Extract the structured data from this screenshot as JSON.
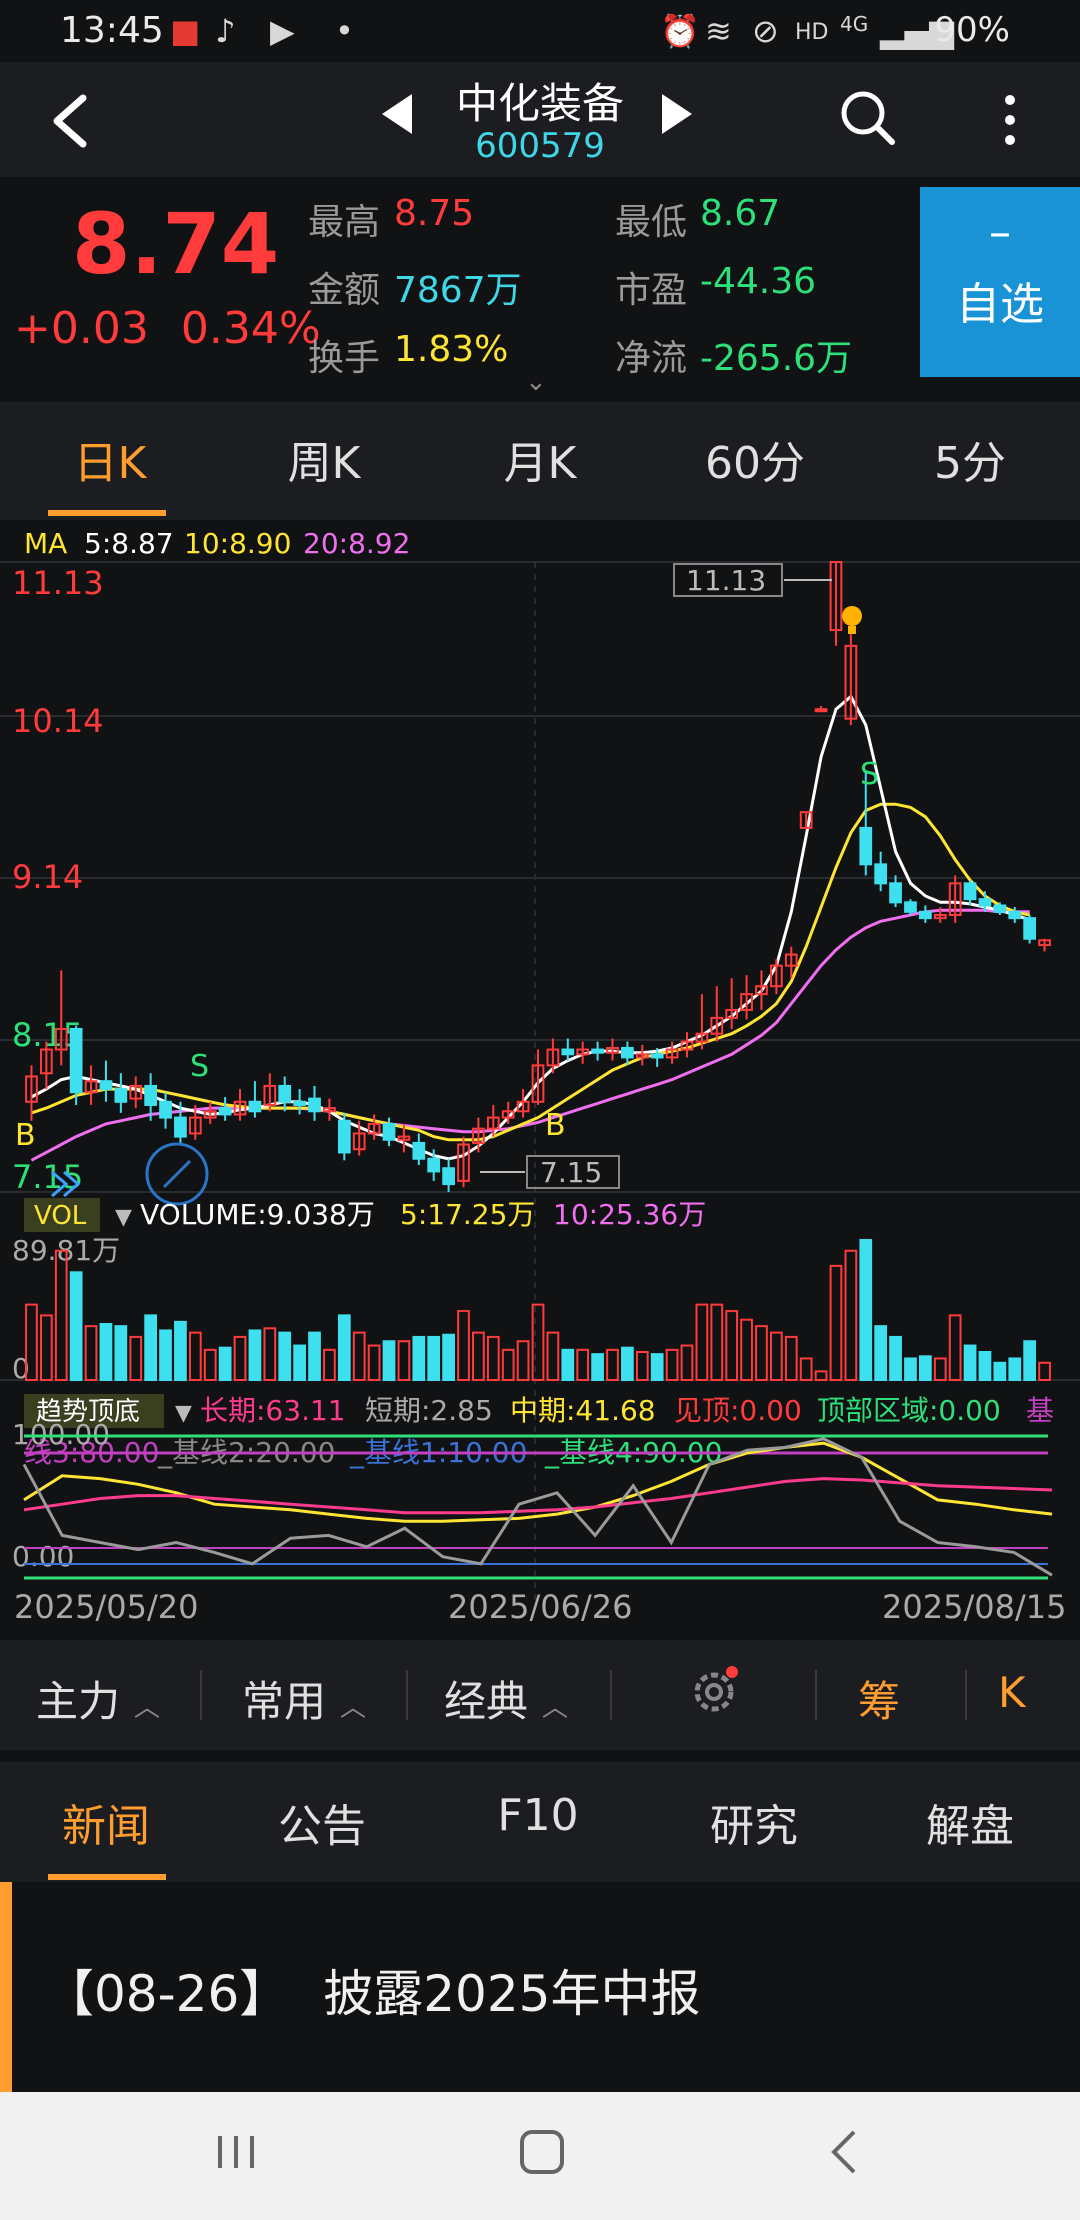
{
  "status_bar": {
    "time": "13:45",
    "network": "4G",
    "hd": "HD",
    "battery": "90%"
  },
  "header": {
    "stock_name": "中化装备",
    "stock_code": "600579"
  },
  "quote": {
    "last_price": "8.74",
    "change": "+0.03",
    "change_pct": "0.34%",
    "fields": [
      {
        "label": "最高",
        "value": "8.75",
        "color": "#ff3b3b"
      },
      {
        "label": "最低",
        "value": "8.67",
        "color": "#2ee07a"
      },
      {
        "label": "金额",
        "value": "7867万",
        "color": "#3ed7e8"
      },
      {
        "label": "市盈",
        "value": "-44.36",
        "color": "#2ee07a"
      },
      {
        "label": "换手",
        "value": "1.83%",
        "color": "#ffe533"
      },
      {
        "label": "净流",
        "value": "-265.6万",
        "color": "#2ee07a"
      }
    ],
    "watch_button": {
      "minus": "–",
      "label": "自选"
    }
  },
  "period_tabs": [
    "日K",
    "周K",
    "月K",
    "60分",
    "5分"
  ],
  "chart": {
    "ma_legend": {
      "label": "MA",
      "ma5": "5:8.87",
      "ma10": "10:8.90",
      "ma20": "20:8.92"
    },
    "price_ticks": [
      "11.13",
      "10.14",
      "9.14",
      "8.15",
      "7.15"
    ],
    "high_marker": "11.13",
    "low_marker": "7.15",
    "buy_label": "B",
    "sell_label": "S",
    "vol_legend": {
      "tag": "VOL",
      "volume": "VOLUME:9.038万",
      "v5": "5:17.25万",
      "v10": "10:25.36万"
    },
    "vol_top": "89.81万",
    "vol_zero": "0",
    "ind_legend": {
      "tag": "趋势顶底",
      "long": "长期:63.11",
      "short": "短期:2.85",
      "mid": "中期:41.68",
      "top_seen": "见顶:0.00",
      "top_zone": "顶部区域:0.00",
      "tail": "基",
      "base_line3": "线3:80.00",
      "base_line2": "_基线2:20.00",
      "base_line1": "_基线1:10.00",
      "base_line4": "_基线4:90.00"
    },
    "ind_top": "100.00",
    "ind_zero": "0.00",
    "dates": [
      "2025/05/20",
      "2025/06/26",
      "2025/08/15"
    ]
  },
  "chart_data": {
    "type": "candlestick",
    "ylim": [
      7.15,
      11.13
    ],
    "candles": [
      {
        "o": 7.72,
        "c": 7.88,
        "h": 7.95,
        "l": 7.6
      },
      {
        "o": 7.9,
        "c": 8.05,
        "h": 8.1,
        "l": 7.8
      },
      {
        "o": 8.05,
        "c": 8.18,
        "h": 8.55,
        "l": 7.95
      },
      {
        "o": 8.18,
        "c": 7.78,
        "h": 8.2,
        "l": 7.7
      },
      {
        "o": 7.78,
        "c": 7.85,
        "h": 7.95,
        "l": 7.7
      },
      {
        "o": 7.85,
        "c": 7.8,
        "h": 7.98,
        "l": 7.72
      },
      {
        "o": 7.8,
        "c": 7.72,
        "h": 7.9,
        "l": 7.65
      },
      {
        "o": 7.74,
        "c": 7.82,
        "h": 7.88,
        "l": 7.68
      },
      {
        "o": 7.82,
        "c": 7.7,
        "h": 7.9,
        "l": 7.6
      },
      {
        "o": 7.72,
        "c": 7.62,
        "h": 7.78,
        "l": 7.55
      },
      {
        "o": 7.62,
        "c": 7.5,
        "h": 7.72,
        "l": 7.45
      },
      {
        "o": 7.52,
        "c": 7.62,
        "h": 7.7,
        "l": 7.48
      },
      {
        "o": 7.62,
        "c": 7.66,
        "h": 7.72,
        "l": 7.58
      },
      {
        "o": 7.68,
        "c": 7.64,
        "h": 7.75,
        "l": 7.6
      },
      {
        "o": 7.64,
        "c": 7.72,
        "h": 7.8,
        "l": 7.6
      },
      {
        "o": 7.72,
        "c": 7.66,
        "h": 7.85,
        "l": 7.62
      },
      {
        "o": 7.7,
        "c": 7.82,
        "h": 7.9,
        "l": 7.66
      },
      {
        "o": 7.82,
        "c": 7.72,
        "h": 7.88,
        "l": 7.66
      },
      {
        "o": 7.72,
        "c": 7.7,
        "h": 7.8,
        "l": 7.64
      },
      {
        "o": 7.74,
        "c": 7.66,
        "h": 7.82,
        "l": 7.6
      },
      {
        "o": 7.66,
        "c": 7.68,
        "h": 7.74,
        "l": 7.6
      },
      {
        "o": 7.6,
        "c": 7.4,
        "h": 7.65,
        "l": 7.35
      },
      {
        "o": 7.42,
        "c": 7.52,
        "h": 7.6,
        "l": 7.38
      },
      {
        "o": 7.52,
        "c": 7.58,
        "h": 7.64,
        "l": 7.48
      },
      {
        "o": 7.58,
        "c": 7.48,
        "h": 7.62,
        "l": 7.44
      },
      {
        "o": 7.48,
        "c": 7.5,
        "h": 7.58,
        "l": 7.4
      },
      {
        "o": 7.46,
        "c": 7.36,
        "h": 7.52,
        "l": 7.32
      },
      {
        "o": 7.36,
        "c": 7.28,
        "h": 7.42,
        "l": 7.22
      },
      {
        "o": 7.3,
        "c": 7.2,
        "h": 7.36,
        "l": 7.15
      },
      {
        "o": 7.22,
        "c": 7.45,
        "h": 7.5,
        "l": 7.18
      },
      {
        "o": 7.46,
        "c": 7.55,
        "h": 7.62,
        "l": 7.4
      },
      {
        "o": 7.55,
        "c": 7.62,
        "h": 7.7,
        "l": 7.5
      },
      {
        "o": 7.62,
        "c": 7.66,
        "h": 7.72,
        "l": 7.58
      },
      {
        "o": 7.66,
        "c": 7.72,
        "h": 7.8,
        "l": 7.62
      },
      {
        "o": 7.72,
        "c": 7.95,
        "h": 8.05,
        "l": 7.7
      },
      {
        "o": 7.95,
        "c": 8.05,
        "h": 8.12,
        "l": 7.9
      },
      {
        "o": 8.05,
        "c": 8.02,
        "h": 8.12,
        "l": 7.98
      },
      {
        "o": 8.02,
        "c": 8.05,
        "h": 8.1,
        "l": 7.96
      },
      {
        "o": 8.05,
        "c": 8.03,
        "h": 8.1,
        "l": 7.98
      },
      {
        "o": 8.03,
        "c": 8.06,
        "h": 8.12,
        "l": 7.98
      },
      {
        "o": 8.06,
        "c": 8.0,
        "h": 8.1,
        "l": 7.95
      },
      {
        "o": 8.0,
        "c": 8.02,
        "h": 8.08,
        "l": 7.95
      },
      {
        "o": 8.02,
        "c": 8.0,
        "h": 8.06,
        "l": 7.94
      },
      {
        "o": 8.0,
        "c": 8.05,
        "h": 8.1,
        "l": 7.96
      },
      {
        "o": 8.05,
        "c": 8.1,
        "h": 8.16,
        "l": 8.0
      },
      {
        "o": 8.1,
        "c": 8.15,
        "h": 8.4,
        "l": 8.05
      },
      {
        "o": 8.15,
        "c": 8.25,
        "h": 8.45,
        "l": 8.1
      },
      {
        "o": 8.25,
        "c": 8.3,
        "h": 8.5,
        "l": 8.18
      },
      {
        "o": 8.3,
        "c": 8.4,
        "h": 8.52,
        "l": 8.24
      },
      {
        "o": 8.4,
        "c": 8.45,
        "h": 8.55,
        "l": 8.3
      },
      {
        "o": 8.45,
        "c": 8.58,
        "h": 8.62,
        "l": 8.4
      },
      {
        "o": 8.58,
        "c": 8.65,
        "h": 8.7,
        "l": 8.5
      },
      {
        "o": 9.45,
        "c": 9.55,
        "h": 9.55,
        "l": 9.45
      },
      {
        "o": 10.2,
        "c": 10.2,
        "h": 10.22,
        "l": 10.18
      },
      {
        "o": 10.7,
        "c": 11.13,
        "h": 11.13,
        "l": 10.6
      },
      {
        "o": 10.14,
        "c": 10.6,
        "h": 10.7,
        "l": 10.1
      },
      {
        "o": 9.45,
        "c": 9.22,
        "h": 9.8,
        "l": 9.15
      },
      {
        "o": 9.22,
        "c": 9.1,
        "h": 9.3,
        "l": 9.05
      },
      {
        "o": 9.1,
        "c": 8.98,
        "h": 9.15,
        "l": 8.95
      },
      {
        "o": 8.98,
        "c": 8.92,
        "h": 9.0,
        "l": 8.9
      },
      {
        "o": 8.92,
        "c": 8.88,
        "h": 8.96,
        "l": 8.85
      },
      {
        "o": 8.88,
        "c": 8.9,
        "h": 8.95,
        "l": 8.85
      },
      {
        "o": 8.9,
        "c": 9.1,
        "h": 9.15,
        "l": 8.85
      },
      {
        "o": 9.1,
        "c": 9.0,
        "h": 9.12,
        "l": 8.96
      },
      {
        "o": 9.0,
        "c": 8.96,
        "h": 9.05,
        "l": 8.92
      },
      {
        "o": 8.96,
        "c": 8.92,
        "h": 8.98,
        "l": 8.9
      },
      {
        "o": 8.92,
        "c": 8.88,
        "h": 8.95,
        "l": 8.85
      },
      {
        "o": 8.88,
        "c": 8.75,
        "h": 8.9,
        "l": 8.72
      },
      {
        "o": 8.71,
        "c": 8.74,
        "h": 8.75,
        "l": 8.67
      }
    ],
    "ma5": [
      7.75,
      7.8,
      7.86,
      7.88,
      7.86,
      7.84,
      7.82,
      7.8,
      7.76,
      7.72,
      7.68,
      7.66,
      7.64,
      7.65,
      7.67,
      7.68,
      7.7,
      7.72,
      7.72,
      7.7,
      7.66,
      7.6,
      7.56,
      7.52,
      7.5,
      7.46,
      7.42,
      7.38,
      7.36,
      7.38,
      7.44,
      7.52,
      7.62,
      7.72,
      7.84,
      7.93,
      7.98,
      8.02,
      8.04,
      8.04,
      8.03,
      8.03,
      8.04,
      8.06,
      8.1,
      8.14,
      8.2,
      8.26,
      8.34,
      8.42,
      8.58,
      8.92,
      9.4,
      9.9,
      10.2,
      10.28,
      10.1,
      9.7,
      9.3,
      9.1,
      9.02,
      8.98,
      8.98,
      8.97,
      8.95,
      8.93,
      8.9,
      8.87
    ],
    "ma10": [
      7.65,
      7.68,
      7.72,
      7.76,
      7.78,
      7.8,
      7.8,
      7.8,
      7.8,
      7.78,
      7.76,
      7.74,
      7.72,
      7.7,
      7.69,
      7.68,
      7.68,
      7.68,
      7.68,
      7.68,
      7.66,
      7.64,
      7.62,
      7.6,
      7.58,
      7.56,
      7.54,
      7.5,
      7.48,
      7.48,
      7.48,
      7.5,
      7.54,
      7.58,
      7.62,
      7.68,
      7.74,
      7.8,
      7.86,
      7.92,
      7.96,
      8.0,
      8.02,
      8.04,
      8.06,
      8.09,
      8.12,
      8.15,
      8.2,
      8.26,
      8.34,
      8.48,
      8.7,
      8.95,
      9.2,
      9.42,
      9.56,
      9.6,
      9.6,
      9.58,
      9.52,
      9.4,
      9.25,
      9.12,
      9.02,
      8.96,
      8.92,
      8.9
    ],
    "ma20": [
      7.35,
      7.4,
      7.45,
      7.5,
      7.54,
      7.58,
      7.6,
      7.62,
      7.64,
      7.65,
      7.66,
      7.67,
      7.68,
      7.68,
      7.68,
      7.68,
      7.68,
      7.68,
      7.68,
      7.67,
      7.66,
      7.64,
      7.62,
      7.6,
      7.58,
      7.57,
      7.56,
      7.55,
      7.54,
      7.53,
      7.53,
      7.54,
      7.55,
      7.57,
      7.59,
      7.62,
      7.65,
      7.68,
      7.71,
      7.74,
      7.77,
      7.8,
      7.83,
      7.86,
      7.9,
      7.94,
      7.98,
      8.02,
      8.08,
      8.14,
      8.22,
      8.34,
      8.46,
      8.58,
      8.68,
      8.76,
      8.82,
      8.86,
      8.88,
      8.9,
      8.92,
      8.93,
      8.93,
      8.93,
      8.93,
      8.92,
      8.92,
      8.92
    ]
  },
  "toolbar": {
    "items": [
      "主力",
      "常用",
      "经典"
    ],
    "chip": "筹",
    "k": "K"
  },
  "news_tabs": [
    "新闻",
    "公告",
    "F10",
    "研究",
    "解盘"
  ],
  "news": [
    {
      "date": "【08-26】",
      "title": "披露2025年中报"
    }
  ]
}
